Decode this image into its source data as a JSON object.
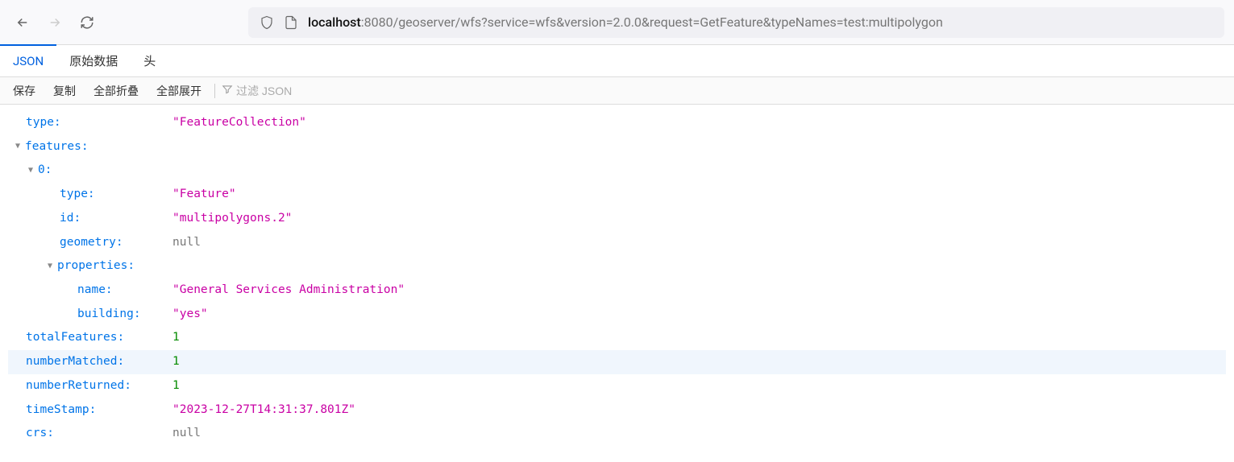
{
  "browser": {
    "url_host": "localhost",
    "url_rest": ":8080/geoserver/wfs?service=wfs&version=2.0.0&request=GetFeature&typeNames=test:multipolygon"
  },
  "tabs": {
    "json": "JSON",
    "raw": "原始数据",
    "headers": "头"
  },
  "toolbar": {
    "save": "保存",
    "copy": "复制",
    "collapse_all": "全部折叠",
    "expand_all": "全部展开",
    "filter_placeholder": "过滤 JSON"
  },
  "json": {
    "type_key": "type",
    "type_val": "\"FeatureCollection\"",
    "features_key": "features",
    "idx0": "0",
    "f_type_key": "type",
    "f_type_val": "\"Feature\"",
    "f_id_key": "id",
    "f_id_val": "\"multipolygons.2\"",
    "f_geom_key": "geometry",
    "f_geom_val": "null",
    "f_props_key": "properties",
    "p_name_key": "name",
    "p_name_val": "\"General Services Administration\"",
    "p_building_key": "building",
    "p_building_val": "\"yes\"",
    "totalFeatures_key": "totalFeatures",
    "totalFeatures_val": "1",
    "numberMatched_key": "numberMatched",
    "numberMatched_val": "1",
    "numberReturned_key": "numberReturned",
    "numberReturned_val": "1",
    "timeStamp_key": "timeStamp",
    "timeStamp_val": "\"2023-12-27T14:31:37.801Z\"",
    "crs_key": "crs",
    "crs_val": "null"
  }
}
